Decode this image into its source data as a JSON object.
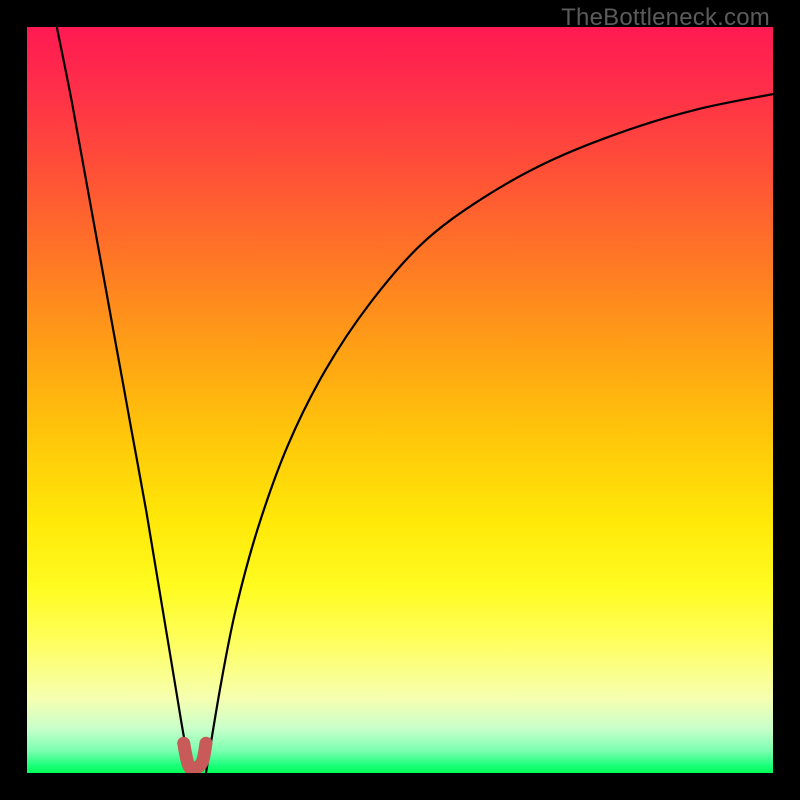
{
  "watermark": "TheBottleneck.com",
  "colors": {
    "page_bg": "#000000",
    "curve": "#000000",
    "nub": "#c85a5a",
    "gradient_top": "#ff1a52",
    "gradient_bottom": "#00ff55"
  },
  "chart_data": {
    "type": "line",
    "title": "",
    "xlabel": "",
    "ylabel": "",
    "xlim": [
      0,
      100
    ],
    "ylim": [
      0,
      100
    ],
    "x_optimal": 22,
    "series": [
      {
        "name": "left-branch",
        "x": [
          4,
          6,
          8,
          10,
          12,
          14,
          16,
          18,
          20,
          21,
          22
        ],
        "values": [
          100,
          90,
          79,
          68,
          57,
          46,
          35,
          23,
          11,
          5,
          0
        ]
      },
      {
        "name": "right-branch",
        "x": [
          24,
          26,
          28,
          31,
          35,
          40,
          46,
          53,
          61,
          70,
          80,
          90,
          100
        ],
        "values": [
          0,
          12,
          22,
          33,
          44,
          54,
          63,
          71,
          77,
          82,
          86,
          89,
          91
        ]
      },
      {
        "name": "optimal-marker",
        "x": [
          21,
          21.5,
          22,
          22.5,
          23.5,
          24
        ],
        "values": [
          4,
          1.5,
          0.5,
          0.5,
          1.5,
          4
        ]
      }
    ]
  }
}
